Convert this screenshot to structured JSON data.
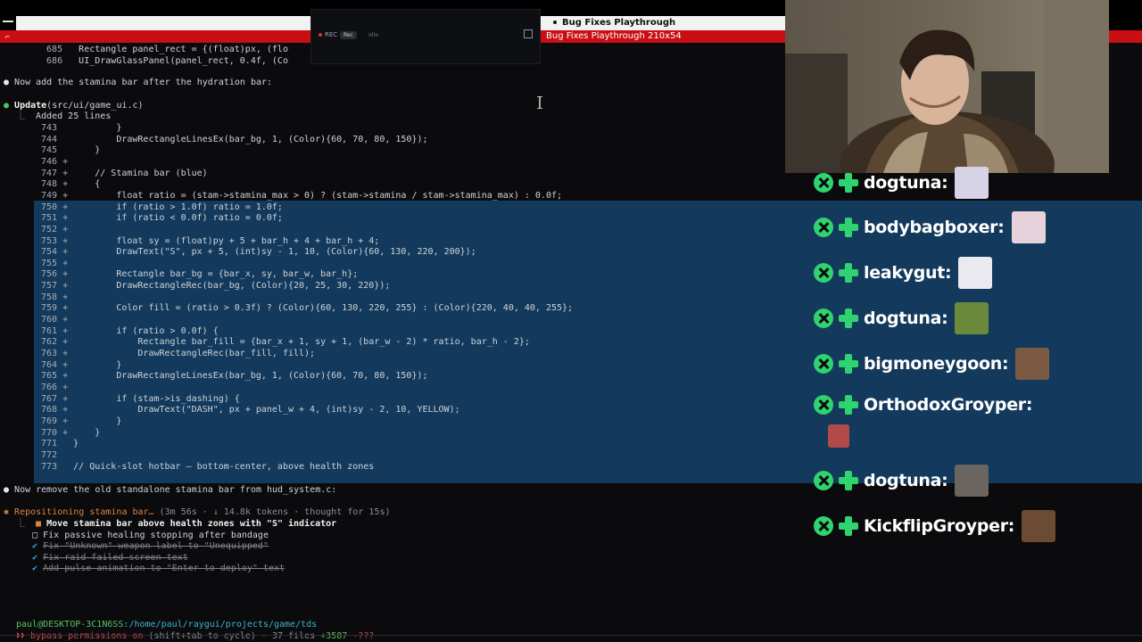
{
  "window": {
    "title": "Bug Fixes Playthrough",
    "tab_title": "Bug Fixes Playthrough 210x54",
    "menu_mark": "⌐"
  },
  "recorder": {
    "rec_label": "REC",
    "pill_active": "Rec",
    "pill_inactive": "Idle"
  },
  "terminal": {
    "top_lines": [
      {
        "n": "685",
        "code": "Rectangle panel_rect = {(float)px, (flo"
      },
      {
        "n": "686",
        "code": "UI_DrawGlassPanel(panel_rect, 0.4f, (Co"
      }
    ],
    "msg1": "Now add the stamina bar after the hydration bar:",
    "update_label": "Update",
    "update_path": "(src/ui/game_ui.c)",
    "added_lines": "Added 25 lines",
    "context_before": [
      {
        "n": "743",
        "mark": " ",
        "code": "        }"
      },
      {
        "n": "744",
        "mark": " ",
        "code": "        DrawRectangleLinesEx(bar_bg, 1, (Color){60, 70, 80, 150});"
      },
      {
        "n": "745",
        "mark": " ",
        "code": "    }"
      }
    ],
    "added": [
      {
        "n": "746",
        "code": ""
      },
      {
        "n": "747",
        "code": "    // Stamina bar (blue)"
      },
      {
        "n": "748",
        "code": "    {"
      },
      {
        "n": "749",
        "code": "        float ratio = (stam->stamina_max > 0) ? (stam->stamina / stam->stamina_max) : 0.0f;"
      },
      {
        "n": "750",
        "code": "        if (ratio > 1.0f) ratio = 1.0f;"
      },
      {
        "n": "751",
        "code": "        if (ratio < 0.0f) ratio = 0.0f;"
      },
      {
        "n": "752",
        "code": ""
      },
      {
        "n": "753",
        "code": "        float sy = (float)py + 5 + bar_h + 4 + bar_h + 4;"
      },
      {
        "n": "754",
        "code": "        DrawText(\"S\", px + 5, (int)sy - 1, 10, (Color){60, 130, 220, 200});"
      },
      {
        "n": "755",
        "code": ""
      },
      {
        "n": "756",
        "code": "        Rectangle bar_bg = {bar_x, sy, bar_w, bar_h};"
      },
      {
        "n": "757",
        "code": "        DrawRectangleRec(bar_bg, (Color){20, 25, 30, 220});"
      },
      {
        "n": "758",
        "code": ""
      },
      {
        "n": "759",
        "code": "        Color fill = (ratio > 0.3f) ? (Color){60, 130, 220, 255} : (Color){220, 40, 40, 255};"
      },
      {
        "n": "760",
        "code": ""
      },
      {
        "n": "761",
        "code": "        if (ratio > 0.0f) {"
      },
      {
        "n": "762",
        "code": "            Rectangle bar_fill = {bar_x + 1, sy + 1, (bar_w - 2) * ratio, bar_h - 2};"
      },
      {
        "n": "763",
        "code": "            DrawRectangleRec(bar_fill, fill);"
      },
      {
        "n": "764",
        "code": "        }"
      },
      {
        "n": "765",
        "code": "        DrawRectangleLinesEx(bar_bg, 1, (Color){60, 70, 80, 150});"
      },
      {
        "n": "766",
        "code": ""
      },
      {
        "n": "767",
        "code": "        if (stam->is_dashing) {"
      },
      {
        "n": "768",
        "code": "            DrawText(\"DASH\", px + panel_w + 4, (int)sy - 2, 10, YELLOW);"
      },
      {
        "n": "769",
        "code": "        }"
      },
      {
        "n": "770",
        "code": "    }"
      }
    ],
    "context_after": [
      {
        "n": "771",
        "code": "}"
      },
      {
        "n": "772",
        "code": ""
      },
      {
        "n": "773",
        "code": "// Quick-slot hotbar — bottom-center, above health zones"
      }
    ],
    "msg2": "Now remove the old standalone stamina bar from hud_system.c:",
    "status_title": "Repositioning stamina bar…",
    "status_meta": "(3m 56s · ↓ 14.8k tokens · thought for 15s)",
    "todos": [
      {
        "state": "active",
        "text": "Move stamina bar above health zones with \"S\" indicator"
      },
      {
        "state": "pending",
        "text": "Fix passive healing stopping after bandage"
      },
      {
        "state": "done",
        "text": "Fix \"Unknown\" weapon label to \"Unequipped\""
      },
      {
        "state": "done",
        "text": "Fix raid failed screen text"
      },
      {
        "state": "done",
        "text": "Add pulse animation to \"Enter to deploy\" text"
      }
    ],
    "prompt_caret": "›",
    "path_user": "paul@DESKTOP-3C1N6SS",
    "path_dir": ":/home/paul/raygui/projects/game/tds",
    "footer_mode": "bypass permissions on",
    "footer_hint": "(shift+tab to cycle) · 37 files",
    "footer_added": "+3587",
    "footer_removed": "-???"
  },
  "chat": {
    "messages": [
      {
        "user": "dogtuna:"
      },
      {
        "user": "bodybagboxer:"
      },
      {
        "user": "leakygut:"
      },
      {
        "user": "dogtuna:"
      },
      {
        "user": "bigmoneygoon:"
      },
      {
        "user": "OrthodoxGroyper:"
      },
      {
        "user": "dogtuna:"
      },
      {
        "user": "KickflipGroyper:"
      }
    ],
    "badge_color": "#2fd36f"
  },
  "colors": {
    "highlight": "#133a5c",
    "tab_bar": "#c90f13",
    "accent_orange": "#e1832f",
    "accent_green": "#4fc35a"
  }
}
